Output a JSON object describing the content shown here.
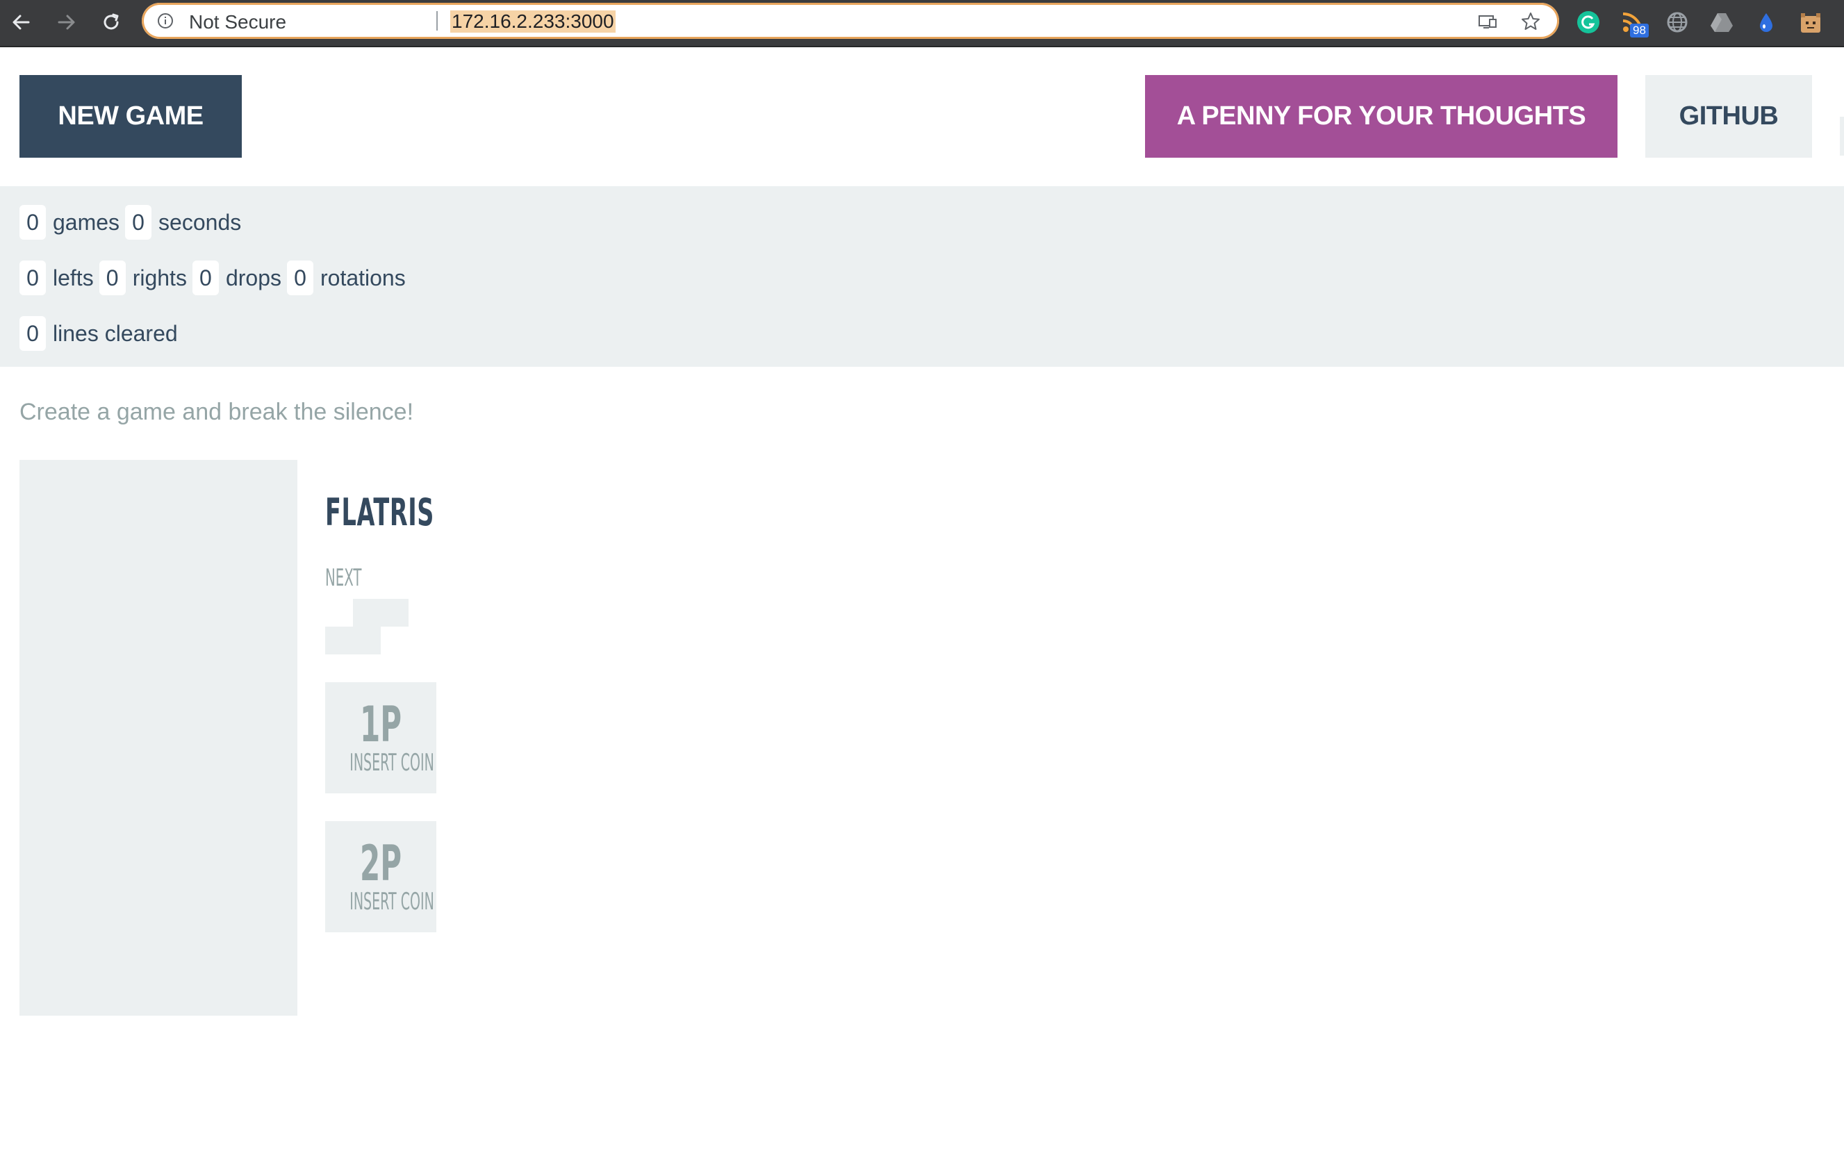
{
  "browser": {
    "security_label": "Not Secure",
    "url": "172.16.2.233:3000",
    "extensions": [
      {
        "icon": "grammarly-icon",
        "color": "#15c39a"
      },
      {
        "icon": "rss-feed-icon",
        "color": "#f2a33a",
        "badge": "98"
      },
      {
        "icon": "globe-icon",
        "color": "#9aa0a6"
      },
      {
        "icon": "drive-icon",
        "color": "#9aa0a6"
      },
      {
        "icon": "drop-icon",
        "color": "#2f6fe0"
      },
      {
        "icon": "robot-icon",
        "color": "#d9a36a"
      }
    ]
  },
  "header": {
    "new_game_label": "NEW GAME",
    "penny_label": "A PENNY FOR YOUR THOUGHTS",
    "github_label": "GITHUB"
  },
  "stats": {
    "games": "0",
    "games_label": "games",
    "seconds": "0",
    "seconds_label": "seconds",
    "lefts": "0",
    "lefts_label": "lefts",
    "rights": "0",
    "rights_label": "rights",
    "drops": "0",
    "drops_label": "drops",
    "rotations": "0",
    "rotations_label": "rotations",
    "lines": "0",
    "lines_label": "lines cleared"
  },
  "message": "Create a game and break the silence!",
  "game": {
    "title": "FLATRIS",
    "next_label": "NEXT",
    "players": [
      {
        "label": "1P",
        "status": "INSERT COIN"
      },
      {
        "label": "2P",
        "status": "INSERT COIN"
      }
    ]
  },
  "colors": {
    "primary": "#34495e",
    "accent": "#a34f97",
    "light": "#ecf0f1",
    "muted": "#95a5a6"
  }
}
